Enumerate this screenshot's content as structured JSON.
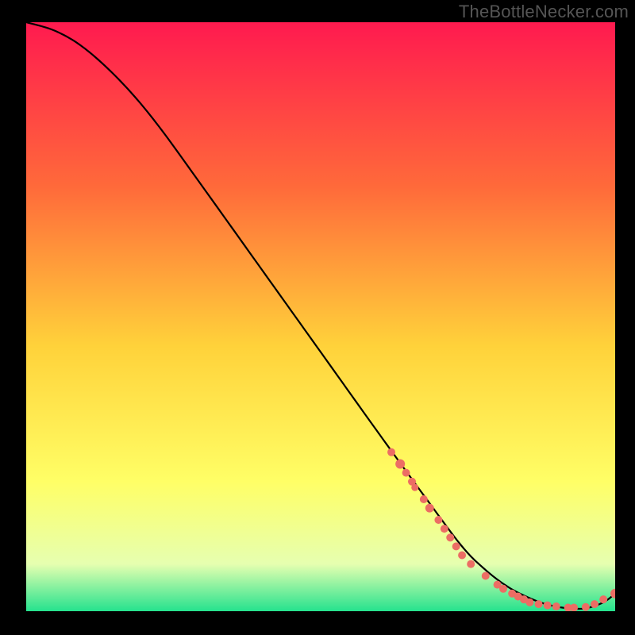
{
  "watermark": "TheBottleNecker.com",
  "colors": {
    "grad_top": "#ff1a4f",
    "grad_mid_upper": "#ff6a3a",
    "grad_mid": "#ffd23a",
    "grad_mid_lower": "#ffff66",
    "grad_near_bottom": "#e6ffb0",
    "grad_bottom": "#25e28e",
    "curve": "#000000",
    "dot": "#ec6d64",
    "background": "#000000"
  },
  "chart_data": {
    "type": "line",
    "title": "",
    "xlabel": "",
    "ylabel": "",
    "xlim": [
      0,
      100
    ],
    "ylim": [
      0,
      100
    ],
    "curve": {
      "x": [
        0,
        5,
        10,
        16,
        22,
        30,
        40,
        50,
        60,
        68,
        74,
        78,
        82,
        86,
        89,
        92,
        95,
        98,
        100
      ],
      "y": [
        100,
        98.5,
        95.5,
        90,
        83,
        72,
        58,
        44,
        30,
        19,
        11,
        7,
        4,
        2,
        1,
        0.5,
        0.5,
        1.5,
        3
      ]
    },
    "series": [
      {
        "name": "points",
        "x": [
          62,
          63.5,
          64.5,
          65.5,
          66,
          67.5,
          68.5,
          70,
          71,
          72,
          73,
          74,
          75.5,
          78,
          80,
          81,
          82.5,
          83.5,
          84.5,
          85.5,
          87,
          88.5,
          90,
          92,
          93,
          95,
          96.5,
          98,
          100
        ],
        "y": [
          27,
          25,
          23.5,
          22,
          21,
          19,
          17.5,
          15.5,
          14,
          12.5,
          11,
          9.5,
          8,
          6,
          4.5,
          3.8,
          3,
          2.5,
          2,
          1.5,
          1.2,
          1,
          0.8,
          0.6,
          0.6,
          0.7,
          1.2,
          2,
          3
        ],
        "sizes": [
          5,
          6,
          5,
          5,
          4.5,
          5,
          5.5,
          5,
          5,
          5,
          5,
          5,
          5,
          5,
          5,
          5,
          5,
          5,
          5,
          5,
          5,
          5,
          5,
          5,
          5,
          5,
          5,
          5,
          6
        ]
      }
    ]
  }
}
